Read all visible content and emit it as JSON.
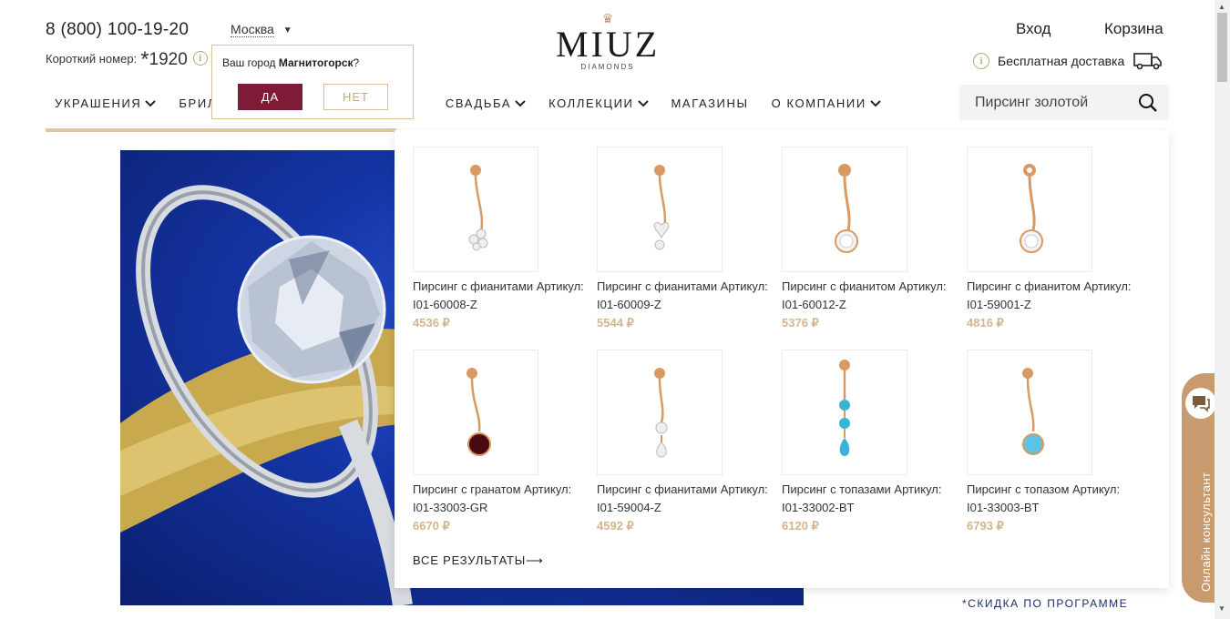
{
  "header": {
    "phone": "8 (800) 100-19-20",
    "short_label": "Короткий номер:",
    "short_star": "*",
    "short_number": "1920",
    "info_glyph": "i",
    "city": "Москва",
    "city_popup": {
      "question_prefix": "Ваш город ",
      "city": "Магнитогорск",
      "question_suffix": "?",
      "yes": "ДА",
      "no": "НЕТ"
    },
    "logo": {
      "word": "MIUZ",
      "sub": "DIAMONDS",
      "crown": "♛"
    },
    "login": "Вход",
    "cart": "Корзина",
    "delivery": "Бесплатная доставка"
  },
  "nav": {
    "items": [
      "УКРАШЕНИЯ",
      "БРИЛ",
      "СВАДЬБА",
      "КОЛЛЕКЦИИ",
      "МАГАЗИНЫ",
      "О КОМПАНИИ"
    ]
  },
  "search": {
    "value": "Пирсинг золотой"
  },
  "results": {
    "items": [
      {
        "title": "Пирсинг с фианитами Артикул: I01-60008-Z",
        "price": "4536 ₽",
        "stone": "cz-flower"
      },
      {
        "title": "Пирсинг с фианитами Артикул: I01-60009-Z",
        "price": "5544 ₽",
        "stone": "cz-heart"
      },
      {
        "title": "Пирсинг с фианитом Артикул: I01-60012-Z",
        "price": "5376 ₽",
        "stone": "cz-round"
      },
      {
        "title": "Пирсинг с фианитом Артикул: I01-59001-Z",
        "price": "4816 ₽",
        "stone": "cz-round-small"
      },
      {
        "title": "Пирсинг с гранатом Артикул: I01-33003-GR",
        "price": "6670 ₽",
        "stone": "garnet"
      },
      {
        "title": "Пирсинг с фианитами Артикул: I01-59004-Z",
        "price": "4592 ₽",
        "stone": "cz-drop"
      },
      {
        "title": "Пирсинг с топазами Артикул: I01-33002-BT",
        "price": "6120 ₽",
        "stone": "topaz-triple"
      },
      {
        "title": "Пирсинг с топазом Артикул: I01-33003-BT",
        "price": "6793 ₽",
        "stone": "topaz"
      }
    ],
    "all_results": "ВСЕ РЕЗУЛЬТАТЫ⟶"
  },
  "promo": {
    "text": "*СКИДКА ПО ПРОГРАММЕ"
  },
  "consultant": {
    "label": "Онлайн консультант"
  },
  "colors": {
    "accent": "#7e1b37",
    "gold": "#d4b58e",
    "consult": "#c79a6f",
    "hero_blue": "#1536a8"
  }
}
